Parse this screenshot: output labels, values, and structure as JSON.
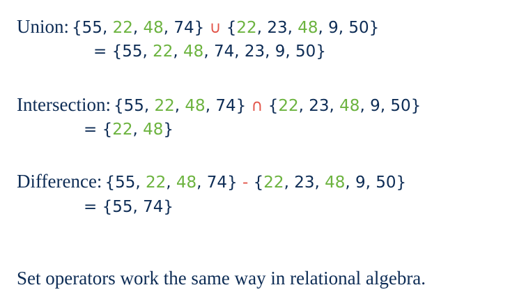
{
  "colors": {
    "text": "#0d2c55",
    "common_element": "#6cb33f",
    "operator": "#e2554a"
  },
  "set_a": [
    "55",
    "22",
    "48",
    "74"
  ],
  "set_b": [
    "22",
    "23",
    "48",
    "9",
    "50"
  ],
  "common_elements": [
    "22",
    "48"
  ],
  "sections": [
    {
      "id": "union",
      "label": "Union:",
      "operator": "∪",
      "result": [
        "55",
        "22",
        "48",
        "74",
        "23",
        "9",
        "50"
      ]
    },
    {
      "id": "intersection",
      "label": "Intersection:",
      "operator": "∩",
      "result": [
        "22",
        "48"
      ]
    },
    {
      "id": "difference",
      "label": "Difference:",
      "operator": "-",
      "result": [
        "55",
        "74"
      ]
    }
  ],
  "footer_text": "Set operators work the same way in relational algebra."
}
